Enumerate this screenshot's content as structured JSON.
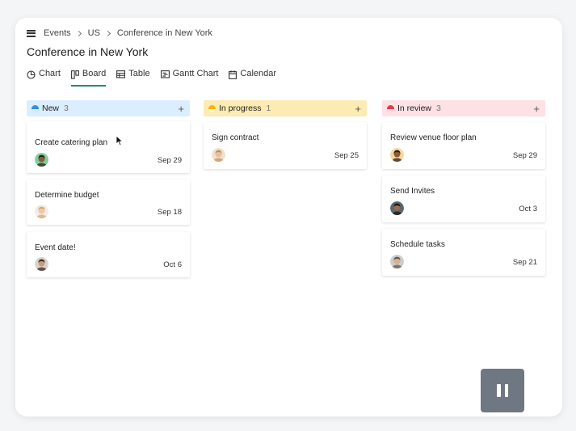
{
  "breadcrumb": {
    "items": [
      "Events",
      "US",
      "Conference in New York"
    ]
  },
  "page": {
    "title": "Conference in New York"
  },
  "tabs": [
    {
      "label": "Chart",
      "icon": "chart-icon",
      "active": false
    },
    {
      "label": "Board",
      "icon": "board-icon",
      "active": true
    },
    {
      "label": "Table",
      "icon": "table-icon",
      "active": false
    },
    {
      "label": "Gantt Chart",
      "icon": "gantt-icon",
      "active": false
    },
    {
      "label": "Calendar",
      "icon": "calendar-icon",
      "active": false
    }
  ],
  "columns": [
    {
      "name": "New",
      "count": "3",
      "add": "+",
      "header_color": "#dbeeff",
      "dot_color": "#2f8fe6",
      "cards": [
        {
          "title": "Create catering plan",
          "date": "Sep 29",
          "avatar_bg": "#7fcf9c",
          "avatar_skin": "#8a5a3b",
          "avatar_hair": "#2e1c12"
        },
        {
          "title": "Determine budget",
          "date": "Sep 18",
          "avatar_bg": "#f1ece6",
          "avatar_skin": "#f0c8a8",
          "avatar_hair": "#d9a66b"
        },
        {
          "title": "Event date!",
          "date": "Oct 6",
          "avatar_bg": "#d8d3cc",
          "avatar_skin": "#c99b7a",
          "avatar_hair": "#3a2b20"
        }
      ]
    },
    {
      "name": "In progress",
      "count": "1",
      "add": "+",
      "header_color": "#fcebb3",
      "dot_color": "#f2b705",
      "cards": [
        {
          "title": "Sign contract",
          "date": "Sep 25",
          "avatar_bg": "#efe1cf",
          "avatar_skin": "#e8bf9a",
          "avatar_hair": "#c49060"
        }
      ]
    },
    {
      "name": "In review",
      "count": "3",
      "add": "+",
      "header_color": "#fde1e4",
      "dot_color": "#e5394d",
      "cards": [
        {
          "title": "Review venue floor plan",
          "date": "Sep 29",
          "avatar_bg": "#f5d99a",
          "avatar_skin": "#8c5a3c",
          "avatar_hair": "#2a1a10"
        },
        {
          "title": "Send Invites",
          "date": "Oct 3",
          "avatar_bg": "#5a6670",
          "avatar_skin": "#9a6b4d",
          "avatar_hair": "#1c1410"
        },
        {
          "title": "Schedule tasks",
          "date": "Sep 21",
          "avatar_bg": "#c9cdd2",
          "avatar_skin": "#d9b08e",
          "avatar_hair": "#6b5340"
        }
      ]
    }
  ],
  "controls": {
    "pause_icon": "pause-icon"
  },
  "colors": {
    "accent": "#1f8a6e",
    "pause_bg": "#6f7782"
  }
}
